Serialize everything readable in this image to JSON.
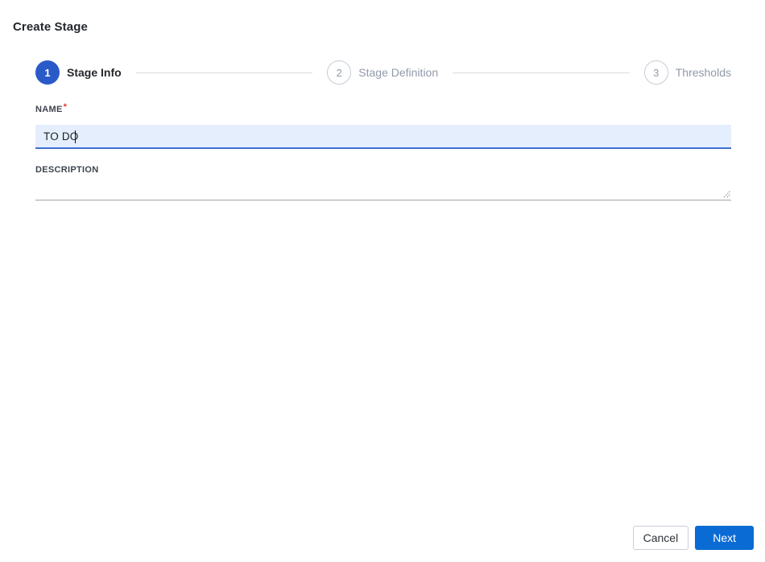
{
  "page": {
    "title": "Create Stage"
  },
  "stepper": {
    "steps": [
      {
        "number": "1",
        "label": "Stage Info",
        "state": "active"
      },
      {
        "number": "2",
        "label": "Stage Definition",
        "state": "inactive"
      },
      {
        "number": "3",
        "label": "Thresholds",
        "state": "inactive"
      }
    ]
  },
  "form": {
    "name": {
      "label": "NAME",
      "required_marker": "*",
      "value": "TO DO"
    },
    "description": {
      "label": "DESCRIPTION",
      "value": ""
    }
  },
  "footer": {
    "cancel_label": "Cancel",
    "next_label": "Next"
  },
  "icons": {
    "resize_handle": "textarea-resize-handle-icon"
  },
  "colors": {
    "active_step_blue": "#2a5ac8",
    "primary_button_blue": "#0b6bd4",
    "required_red": "#e5392e",
    "input_focus_background": "#e5eefc",
    "input_focus_underline": "#3f6fd1",
    "inactive_step_gray": "#9199a9",
    "connector_gray": "#d9dce2"
  }
}
